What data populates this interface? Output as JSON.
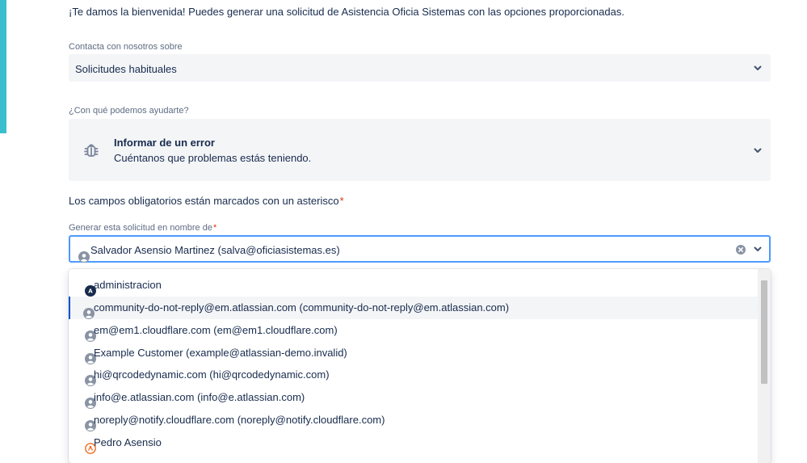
{
  "welcome_text": "¡Te damos la bienvenida! Puedes generar una solicitud de Asistencia Oficia Sistemas con las opciones proporcionadas.",
  "contact": {
    "label": "Contacta con nosotros sobre",
    "selected": "Solicitudes habituales"
  },
  "help": {
    "label": "¿Con qué podemos ayudarte?",
    "title": "Informar de un error",
    "description": "Cuéntanos que problemas estás teniendo."
  },
  "required_notice": "Los campos obligatorios están marcados con un asterisco",
  "required_mark": "*",
  "on_behalf": {
    "label": "Generar esta solicitud en nombre de",
    "value": "Salvador Asensio Martinez (salva@oficiasistemas.es)"
  },
  "options": [
    {
      "label": "administracion",
      "avatar": "letter-avatar",
      "letter": "A"
    },
    {
      "label": "community-do-not-reply@em.atlassian.com (community-do-not-reply@em.atlassian.com)",
      "avatar": "person-icon"
    },
    {
      "label": "em@em1.cloudflare.com (em@em1.cloudflare.com)",
      "avatar": "person-icon"
    },
    {
      "label": "Example Customer (example@atlassian-demo.invalid)",
      "avatar": "person-icon"
    },
    {
      "label": "hi@qrcodedynamic.com (hi@qrcodedynamic.com)",
      "avatar": "person-icon"
    },
    {
      "label": "info@e.atlassian.com (info@e.atlassian.com)",
      "avatar": "person-icon"
    },
    {
      "label": "noreply@notify.cloudflare.com (noreply@notify.cloudflare.com)",
      "avatar": "person-icon"
    },
    {
      "label": "Pedro Asensio",
      "avatar": "photo-avatar"
    }
  ],
  "colors": {
    "accent": "#3bbfcf",
    "focus_border": "#4c9aff",
    "active_marker": "#0052cc",
    "required": "#de350b"
  }
}
